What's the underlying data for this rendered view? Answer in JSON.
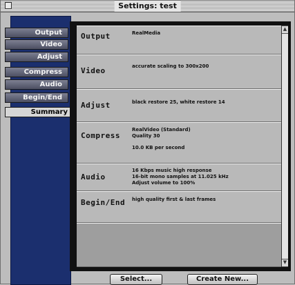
{
  "window": {
    "title": "Settings: test"
  },
  "sidebar": {
    "items": [
      {
        "label": "Output",
        "selected": false
      },
      {
        "label": "Video",
        "selected": false
      },
      {
        "label": "Adjust",
        "selected": false
      },
      {
        "label": "Compress",
        "selected": false
      },
      {
        "label": "Audio",
        "selected": false
      },
      {
        "label": "Begin/End",
        "selected": false
      },
      {
        "label": "Summary",
        "selected": true
      }
    ]
  },
  "summary": {
    "rows": [
      {
        "label": "Output",
        "values": [
          "RealMedia"
        ]
      },
      {
        "label": "Video",
        "values": [
          "accurate scaling to 300x200"
        ]
      },
      {
        "label": "Adjust",
        "values": [
          "black restore 25, white restore 14"
        ]
      },
      {
        "label": "Compress",
        "values": [
          "RealVideo (Standard)",
          "Quality 30",
          "10.0 KB per second"
        ]
      },
      {
        "label": "Audio",
        "values": [
          "16 Kbps music high response",
          "16-bit mono samples at 11.025 kHz",
          "Adjust volume to 100%"
        ]
      },
      {
        "label": "Begin/End",
        "values": [
          "high quality first & last frames"
        ]
      }
    ]
  },
  "buttons": {
    "select": "Select...",
    "create_new": "Create New..."
  },
  "colors": {
    "sidebar_bg": "#1b2f6e",
    "panel_bg": "#111111",
    "content_bg": "#b9b9b9"
  }
}
